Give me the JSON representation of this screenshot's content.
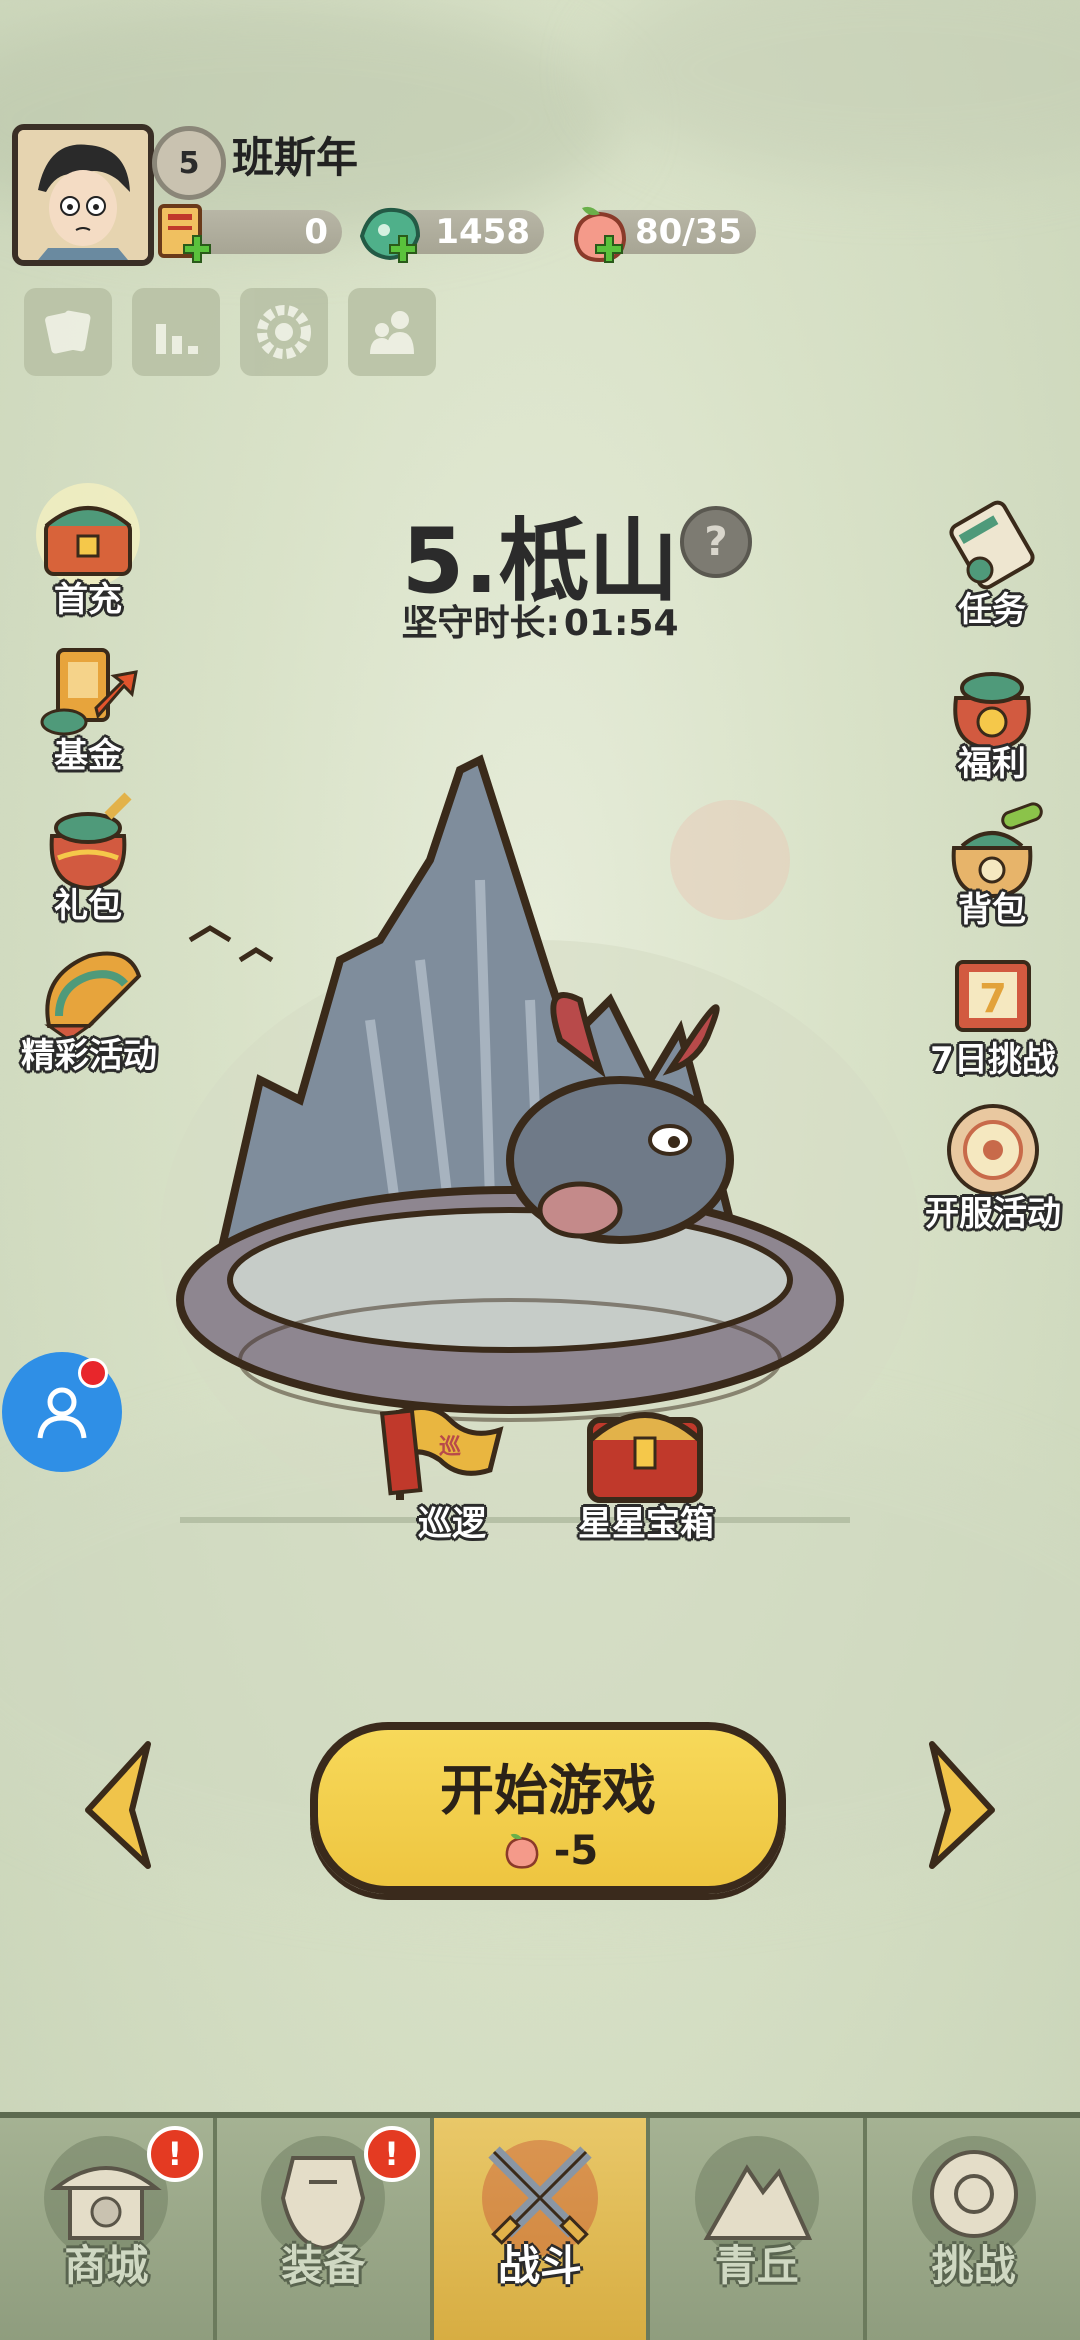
{
  "player": {
    "level": "5",
    "name": "班斯年"
  },
  "resources": {
    "tickets": "0",
    "jade": "1458",
    "stamina": "80/35"
  },
  "left_menu": {
    "first_charge": "首充",
    "fund": "基金",
    "gift": "礼包",
    "events": "精彩活动"
  },
  "right_menu": {
    "tasks": "任务",
    "welfare": "福利",
    "bag": "背包",
    "seven_day": "7日挑战",
    "server_event": "开服活动"
  },
  "stage": {
    "title": "5.柢山",
    "help": "?",
    "timer_label": "坚守时长:",
    "timer_value": "01:54"
  },
  "scene": {
    "patrol": "巡逻",
    "patrol_flag": "巡",
    "star_chest": "星星宝箱"
  },
  "start": {
    "label": "开始游戏",
    "cost": "-5"
  },
  "nav": {
    "shop": "商城",
    "equip": "装备",
    "battle": "战斗",
    "hills": "青丘",
    "challenge": "挑战",
    "alert": "!"
  },
  "colors": {
    "accent": "#eec540",
    "nav_active": "#d7ad42",
    "support": "#2f8fe6"
  }
}
